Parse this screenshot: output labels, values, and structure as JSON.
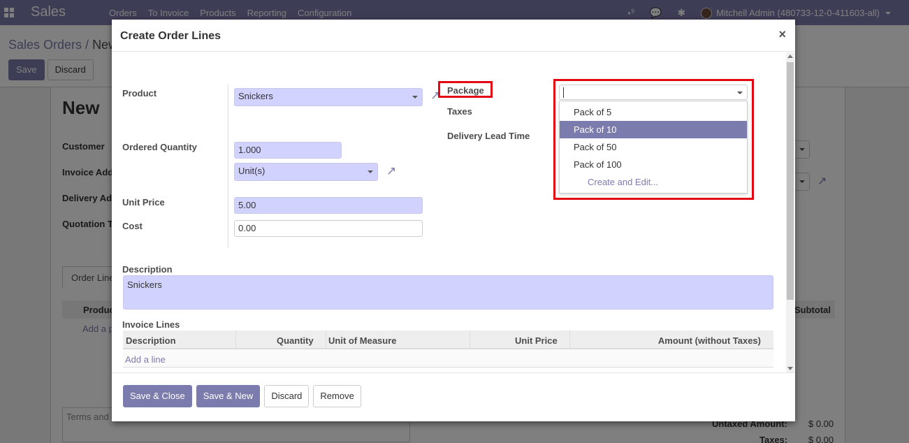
{
  "navbar": {
    "app_name": "Sales",
    "menu": [
      "Orders",
      "To Invoice",
      "Products",
      "Reporting",
      "Configuration"
    ],
    "systray": {
      "activity_icon": "clock-icon",
      "activity_count": "9",
      "messages_icon": "chat-icon",
      "debug_icon": "bug-icon",
      "user_name": "Mitchell Admin (480733-12-0-411603-all)"
    }
  },
  "control_panel": {
    "breadcrumb_parent": "Sales Orders",
    "breadcrumb_sep": " / ",
    "breadcrumb_current": "New",
    "save_label": "Save",
    "discard_label": "Discard"
  },
  "background_form": {
    "title": "New",
    "labels": {
      "customer": "Customer",
      "invoice_address": "Invoice Address",
      "delivery_address": "Delivery Address",
      "quotation_template": "Quotation Template"
    },
    "tab_order_lines": "Order Lines",
    "lines_header_product": "Product",
    "lines_header_subtotal": "Subtotal",
    "add_product": "Add a product",
    "terms_placeholder": "Terms and conditions...",
    "untaxed_label": "Untaxed Amount:",
    "untaxed_value": "$ 0.00",
    "taxes_label": "Taxes:",
    "taxes_value": "$ 0.00"
  },
  "modal": {
    "title": "Create Order Lines",
    "close_label": "×",
    "fields": {
      "product_label": "Product",
      "product_value": "Snickers",
      "ordered_qty_label": "Ordered Quantity",
      "ordered_qty_value": "1.000",
      "uom_value": "Unit(s)",
      "unit_price_label": "Unit Price",
      "unit_price_value": "5.00",
      "cost_label": "Cost",
      "cost_value": "0.00",
      "package_label": "Package",
      "package_value": "",
      "taxes_label": "Taxes",
      "delivery_lead_time_label": "Delivery Lead Time",
      "description_label": "Description",
      "description_value": "Snickers"
    },
    "package_dropdown": {
      "options": [
        "Pack of 5",
        "Pack of 10",
        "Pack of 50",
        "Pack of 100"
      ],
      "highlighted": "Pack of 10",
      "create_label": "Create and Edit..."
    },
    "invoice_lines": {
      "label": "Invoice Lines",
      "columns": [
        "Description",
        "Quantity",
        "Unit of Measure",
        "Unit Price",
        "Amount (without Taxes)"
      ],
      "add_line": "Add a line"
    },
    "footer": {
      "save_close": "Save & Close",
      "save_new": "Save & New",
      "discard": "Discard",
      "remove": "Remove"
    }
  },
  "colors": {
    "brand": "#7c7bad",
    "required_field": "#d2d2ff",
    "highlight_annotation": "#e30613"
  }
}
